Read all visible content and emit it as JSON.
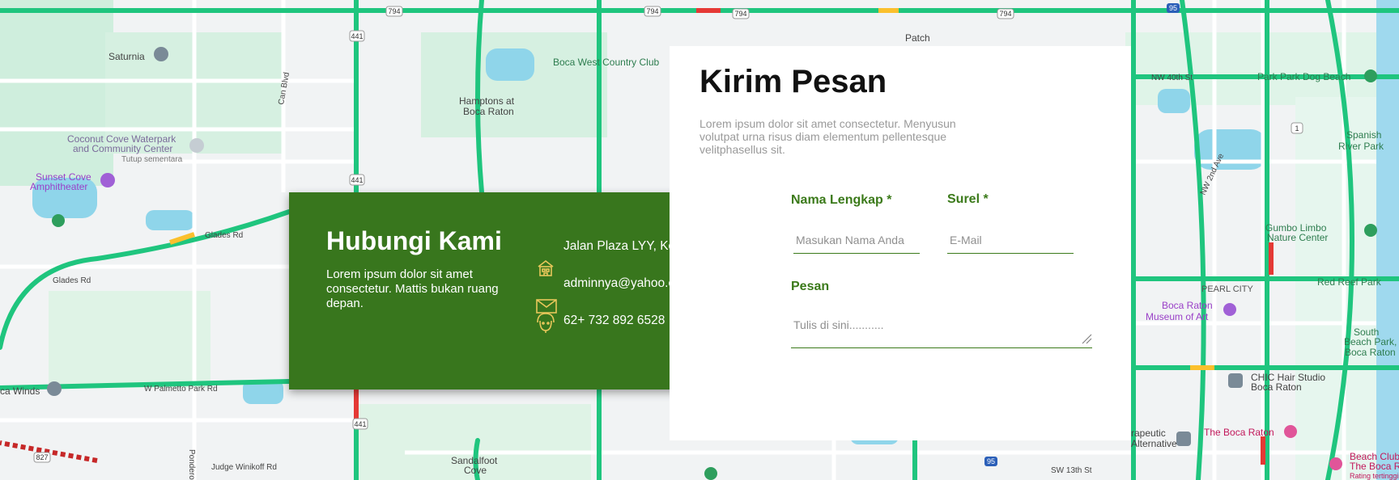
{
  "colors": {
    "panel_green": "#38761d",
    "label_green": "#3b7a1a",
    "icon_gold": "#e8c75a",
    "road_green": "#1fc57e",
    "water_blue": "#7fd3ea"
  },
  "map": {
    "place_labels": [
      "Saturnia",
      "Coconut Cove Waterpark",
      "and Community Center",
      "Tutup sementara",
      "Sunset Cove",
      "Amphitheater",
      "Hamptons at",
      "Boca Raton",
      "Boca West Country Club",
      "Patch",
      "Glades Rd",
      "Glades Rd",
      "ca Winds",
      "W Palmetto Park Rd",
      "Ponderosa Dr",
      "Judge Winikoff Rd",
      "Sandalfoot",
      "Cove",
      "Can Blvd",
      "NW 40th St",
      "Park Park Dog Beach",
      "Spanish",
      "River Park",
      "NW 2nd Ave",
      "Gumbo Limbo",
      "Nature Center",
      "Red Reef Park",
      "PEARL CITY",
      "Boca Raton",
      "Museum of Art",
      "South",
      "Beach Park,",
      "Boca Raton",
      "CHIC Hair Studio",
      "Boca Raton",
      "rapeutic",
      "Alternative",
      "The Boca Raton",
      "SW 13th St",
      "Beach Club",
      "The Boca R",
      "Rating tertinggi"
    ],
    "route_shields": [
      "794",
      "794",
      "794",
      "794",
      "441",
      "441",
      "441",
      "95",
      "95",
      "827",
      "1"
    ]
  },
  "contact": {
    "title": "Hubungi Kami",
    "description": "Lorem ipsum dolor sit amet consectetur. Mattis bukan ruang depan.",
    "address": "Jalan Plaza LYY, Kota XUI. LYY",
    "email": "adminnya@yahoo.com",
    "phone": "62+ 732 892 6528",
    "icons": [
      "building-icon",
      "mail-icon",
      "phone-support-icon"
    ]
  },
  "form": {
    "title": "Kirim Pesan",
    "description": "Lorem ipsum dolor sit amet consectetur. Menyusun volutpat urna risus diam elementum pellentesque velitphasellus sit.",
    "name_label": "Nama Lengkap *",
    "name_placeholder": "Masukan Nama Anda",
    "email_label": "Surel *",
    "email_placeholder": "E-Mail",
    "message_label": "Pesan",
    "message_placeholder": "Tulis di sini..........."
  }
}
